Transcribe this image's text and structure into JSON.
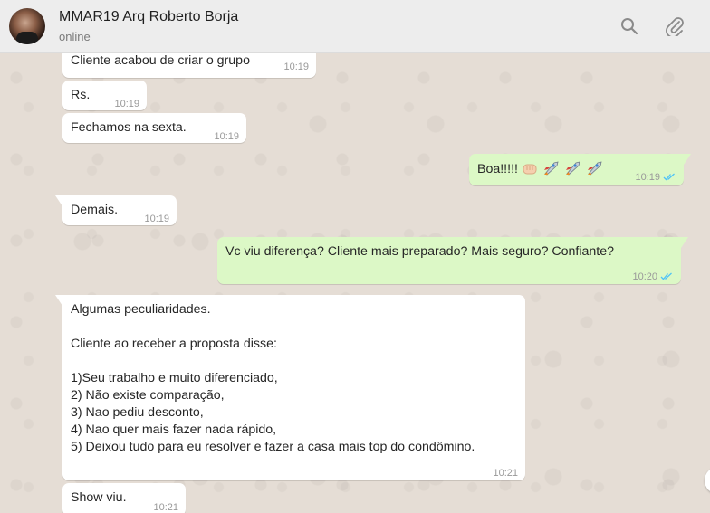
{
  "header": {
    "contact_name": "MMAR19 Arq Roberto Borja",
    "status": "online",
    "icons": [
      "search-icon",
      "attach-icon"
    ]
  },
  "colors": {
    "incoming_bubble": "#ffffff",
    "outgoing_bubble": "#dcf8c6",
    "chat_background": "#e5ddd5",
    "read_ticks": "#4fc3f7"
  },
  "messages": [
    {
      "direction": "in",
      "text": "Cliente acabou de criar o grupo",
      "time": "10:19"
    },
    {
      "direction": "in",
      "text": "Rs.",
      "time": "10:19"
    },
    {
      "direction": "in",
      "text": "Fechamos na sexta.",
      "time": "10:19"
    },
    {
      "direction": "out",
      "text": "Boa!!!!!",
      "emojis": [
        "fist-bump-emoji",
        "rocket-emoji",
        "rocket-emoji",
        "rocket-emoji"
      ],
      "time": "10:19",
      "status": "read"
    },
    {
      "direction": "in",
      "text": "Demais.",
      "time": "10:19"
    },
    {
      "direction": "out",
      "text": "Vc viu diferença? Cliente mais preparado? Mais seguro? Confiante?",
      "time": "10:20",
      "status": "read"
    },
    {
      "direction": "in",
      "text": "Algumas peculiaridades.\n\nCliente ao receber a proposta disse:\n\n1)Seu trabalho e muito diferenciado,\n2) Não existe comparação,\n3) Nao pediu desconto,\n4) Nao quer mais fazer nada rápido,\n5) Deixou tudo para eu resolver e fazer a casa mais top do condômino.",
      "time": "10:21"
    },
    {
      "direction": "in",
      "text": "Show viu.",
      "time": "10:21"
    }
  ]
}
